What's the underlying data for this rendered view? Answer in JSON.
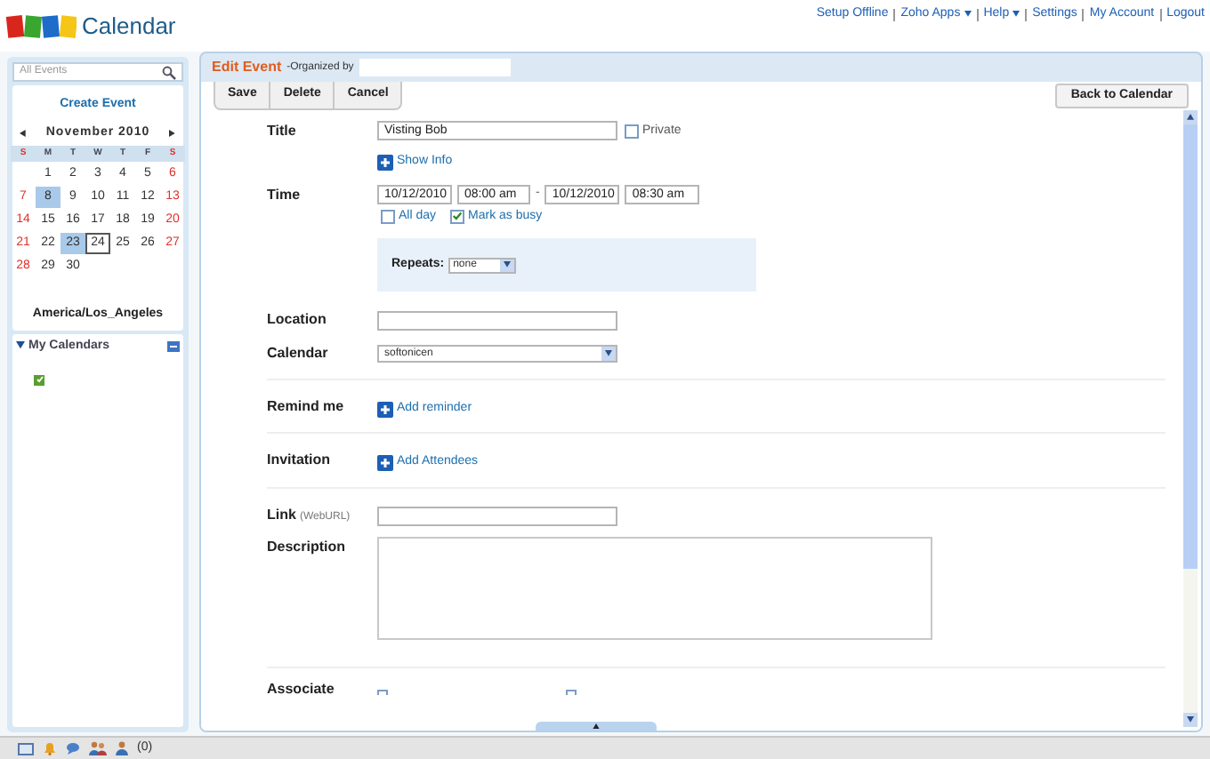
{
  "header": {
    "app_name": "Calendar",
    "links": [
      {
        "label": "Setup Offline",
        "dropdown": false
      },
      {
        "label": "Zoho Apps",
        "dropdown": true
      },
      {
        "label": "Help",
        "dropdown": true
      },
      {
        "label": "Settings",
        "dropdown": false
      },
      {
        "label": "My Account",
        "dropdown": false
      },
      {
        "label": "Logout",
        "dropdown": false
      }
    ]
  },
  "sidebar": {
    "search": {
      "placeholder": "All Events"
    },
    "create_button": "Create Event",
    "mini_calendar": {
      "month": "November 2010",
      "weekdays": [
        "S",
        "M",
        "T",
        "W",
        "T",
        "F",
        "S"
      ],
      "weeks": [
        {
          "right_aligned": true,
          "days": [
            {
              "day": "1",
              "highlighted": false,
              "today": false
            },
            {
              "day": "2",
              "highlighted": false,
              "today": false
            },
            {
              "day": "3",
              "highlighted": false,
              "today": false
            },
            {
              "day": "4",
              "highlighted": false,
              "today": false
            },
            {
              "day": "5",
              "highlighted": false,
              "today": false
            },
            {
              "day": "6",
              "highlighted": false,
              "today": false
            }
          ]
        },
        {
          "days": [
            {
              "day": "7",
              "highlighted": false,
              "today": false
            },
            {
              "day": "8",
              "highlighted": true,
              "today": false
            },
            {
              "day": "9",
              "highlighted": false,
              "today": false
            },
            {
              "day": "10",
              "highlighted": false,
              "today": false
            },
            {
              "day": "11",
              "highlighted": false,
              "today": false
            },
            {
              "day": "12",
              "highlighted": false,
              "today": false
            },
            {
              "day": "13",
              "highlighted": false,
              "today": false
            }
          ]
        },
        {
          "days": [
            {
              "day": "14",
              "highlighted": false,
              "today": false
            },
            {
              "day": "15",
              "highlighted": false,
              "today": false
            },
            {
              "day": "16",
              "highlighted": false,
              "today": false
            },
            {
              "day": "17",
              "highlighted": false,
              "today": false
            },
            {
              "day": "18",
              "highlighted": false,
              "today": false
            },
            {
              "day": "19",
              "highlighted": false,
              "today": false
            },
            {
              "day": "20",
              "highlighted": false,
              "today": false
            }
          ]
        },
        {
          "days": [
            {
              "day": "21",
              "highlighted": false,
              "today": false
            },
            {
              "day": "22",
              "highlighted": false,
              "today": false
            },
            {
              "day": "23",
              "highlighted": true,
              "today": false
            },
            {
              "day": "24",
              "highlighted": false,
              "today": true
            },
            {
              "day": "25",
              "highlighted": false,
              "today": false
            },
            {
              "day": "26",
              "highlighted": false,
              "today": false
            },
            {
              "day": "27",
              "highlighted": false,
              "today": false
            }
          ]
        },
        {
          "right_aligned": false,
          "days": [
            {
              "day": "28",
              "highlighted": false,
              "today": false
            },
            {
              "day": "29",
              "highlighted": false,
              "today": false
            },
            {
              "day": "30",
              "highlighted": false,
              "today": false
            }
          ]
        }
      ]
    },
    "timezone": "America/Los_Angeles",
    "my_calendars": {
      "title": "My Calendars",
      "expanded": true,
      "calendars": [
        {
          "checked": true,
          "color": "#5a9e2f"
        }
      ]
    }
  },
  "editor": {
    "title": "Edit Event",
    "organized_by_label": "-Organized by",
    "toolbar": [
      "Save",
      "Delete",
      "Cancel"
    ],
    "back_button": "Back to Calendar",
    "title_field": {
      "label": "Title",
      "value": "Visting Bob",
      "private_label": "Private",
      "private_checked": false
    },
    "show_info": "Show Info",
    "time": {
      "label": "Time",
      "start_date": "10/12/2010",
      "start_time": "08:00 am",
      "separator": "-",
      "end_date": "10/12/2010",
      "end_time": "08:30 am",
      "all_day": {
        "label": "All day",
        "checked": false
      },
      "busy": {
        "label": "Mark as busy",
        "checked": true
      }
    },
    "repeats": {
      "label": "Repeats:",
      "value": "none"
    },
    "location": {
      "label": "Location"
    },
    "calendar": {
      "label": "Calendar",
      "value": "softonicen"
    },
    "remind": {
      "label": "Remind me",
      "action": "Add reminder"
    },
    "invitation": {
      "label": "Invitation",
      "action": "Add Attendees"
    },
    "link": {
      "label": "Link",
      "hint": "(WebURL)"
    },
    "description": {
      "label": "Description"
    },
    "associate": {
      "label": "Associate"
    }
  },
  "taskbar": {
    "count": "(0)"
  }
}
